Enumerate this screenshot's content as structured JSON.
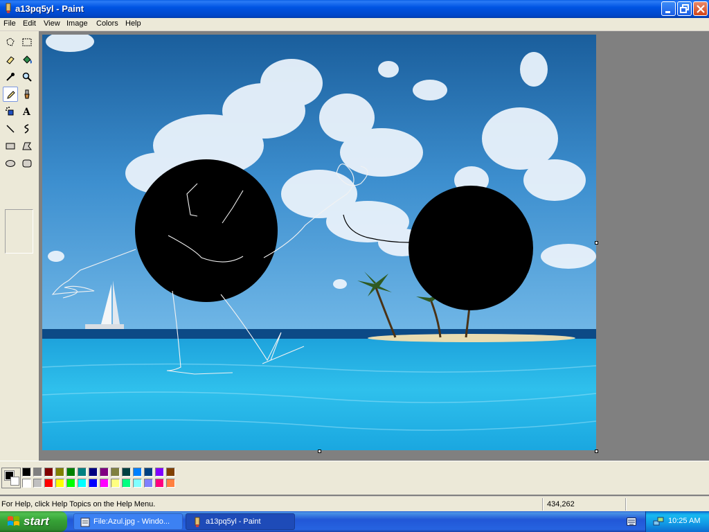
{
  "window": {
    "title": "a13pq5yl - Paint"
  },
  "menu": [
    "File",
    "Edit",
    "View",
    "Image",
    "Colors",
    "Help"
  ],
  "tools": [
    "free-form-select-icon",
    "select-icon",
    "eraser-icon",
    "fill-icon",
    "pick-color-icon",
    "magnifier-icon",
    "pencil-icon",
    "brush-icon",
    "airbrush-icon",
    "text-icon",
    "line-icon",
    "curve-icon",
    "rectangle-icon",
    "polygon-icon",
    "ellipse-icon",
    "rounded-rectangle-icon"
  ],
  "active_tool": "pencil-icon",
  "palette": {
    "foreground": "#000000",
    "background": "#ffffff",
    "top_row": [
      "#000000",
      "#808080",
      "#800000",
      "#808000",
      "#008000",
      "#008080",
      "#000080",
      "#800080",
      "#808040",
      "#004040",
      "#0080ff",
      "#004080",
      "#8000ff",
      "#804000"
    ],
    "bottom_row": [
      "#ffffff",
      "#c0c0c0",
      "#ff0000",
      "#ffff00",
      "#00ff00",
      "#00ffff",
      "#0000ff",
      "#ff00ff",
      "#ffff80",
      "#00ff80",
      "#80ffff",
      "#8080ff",
      "#ff0080",
      "#ff8040"
    ]
  },
  "status": {
    "help": "For Help, click Help Topics on the Help Menu.",
    "coords": "434,262"
  },
  "taskbar": {
    "start_label": "start",
    "tasks": [
      "File:Azul.jpg - Windo...",
      "a13pq5yl - Paint"
    ],
    "clock": "10:25 AM"
  }
}
